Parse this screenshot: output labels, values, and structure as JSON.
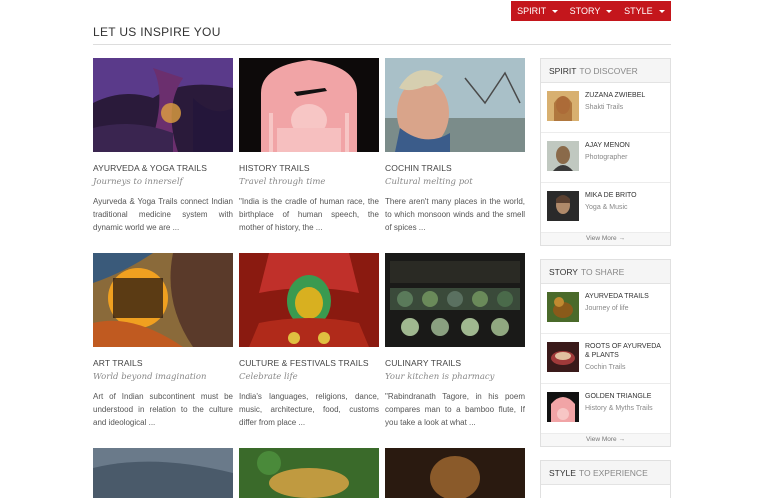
{
  "nav": {
    "items": [
      {
        "label": "SPIRIT"
      },
      {
        "label": "STORY"
      },
      {
        "label": "STYLE"
      }
    ]
  },
  "page": {
    "title": "LET US INSPIRE YOU"
  },
  "cards": [
    {
      "title": "AYURVEDA & YOGA TRAILS",
      "tagline": "Journeys to innerself",
      "desc": "Ayurveda & Yoga Trails connect Indian traditional medicine system with dynamic world we are ..."
    },
    {
      "title": "HISTORY TRAILS",
      "tagline": "Travel through time",
      "desc": "\"India is the cradle of human race, the birthplace of human speech, the mother of history, the ..."
    },
    {
      "title": "COCHIN TRAILS",
      "tagline": "Cultural melting pot",
      "desc": "There aren't many places in the world, to which monsoon winds and the smell of spices ..."
    },
    {
      "title": "ART TRAILS",
      "tagline": "World beyond imagination",
      "desc": "Art of Indian subcontinent must be understood in relation to the culture and ideological ..."
    },
    {
      "title": "CULTURE & FESTIVALS TRAILS",
      "tagline": "Celebrate life",
      "desc": "India's languages, religions, dance, music, architecture, food, customs differ from place ..."
    },
    {
      "title": "CULINARY TRAILS",
      "tagline": "Your kitchen is pharmacy",
      "desc": "\"Rabindranath Tagore, in his poem compares man to a bamboo flute, If you take a look at what ..."
    }
  ],
  "sidebar": {
    "spirit": {
      "head_strong": "SPIRIT",
      "head_light": "TO DISCOVER",
      "items": [
        {
          "name": "ZUZANA ZWIEBEL",
          "sub": "Shakti Trails"
        },
        {
          "name": "AJAY MENON",
          "sub": "Photographer"
        },
        {
          "name": "MIKA DE BRITO",
          "sub": "Yoga & Music"
        }
      ],
      "view_more": "View More →"
    },
    "story": {
      "head_strong": "STORY",
      "head_light": "TO SHARE",
      "items": [
        {
          "name": "AYURVEDA TRAILS",
          "sub": "Journey of life"
        },
        {
          "name": "ROOTS OF AYURVEDA & PLANTS",
          "sub": "Cochin Trails"
        },
        {
          "name": "GOLDEN TRIANGLE",
          "sub": "History & Myths Trails"
        }
      ],
      "view_more": "View More →"
    },
    "style": {
      "head_strong": "STYLE",
      "head_light": "TO EXPERIENCE"
    }
  }
}
